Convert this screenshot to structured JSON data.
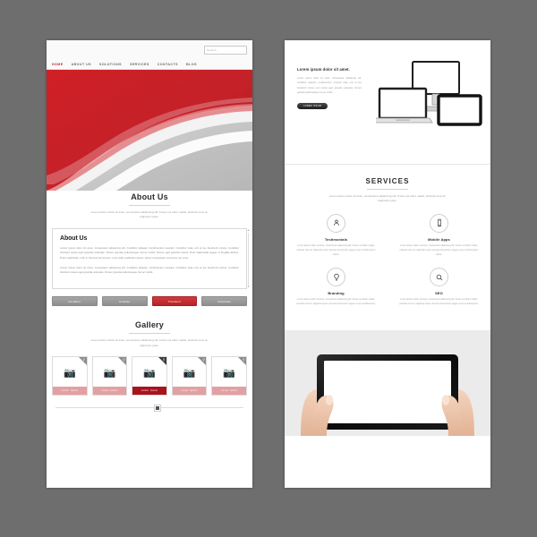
{
  "meta": {
    "background_color": "#6e6e6e",
    "accent_red": "#b5222a",
    "accent_dark": "#1d1d1d"
  },
  "left_page": {
    "header": {
      "search": {
        "placeholder": "Search",
        "value": ""
      },
      "nav_items": [
        {
          "label": "HOME",
          "active": true
        },
        {
          "label": "ABOUT US",
          "active": false
        },
        {
          "label": "SOLUTIONS",
          "active": false
        },
        {
          "label": "SERVICES",
          "active": false
        },
        {
          "label": "CONTACTS",
          "active": false
        },
        {
          "label": "BLOG",
          "active": false
        }
      ]
    },
    "hero": {
      "icon": "red-wave-banner"
    },
    "about": {
      "title": "About Us",
      "subtitle": "Lorem ipsum dolor sit amet, consectetur adipiscing elit. Fusce vel dolor mattis, pulvinar risus id, dignissim justo.",
      "box_title": "About Us",
      "paragraph_1": "Lorem ipsum dolor sit amet, consectetur adipiscing elit. Curabitur aliquam condimentum suscipit. Curabitur vitae orci et leo hendrerit cursus. Curabitur tincidunt metus eget gravida vulputate. Donec gravida pellentesque nisi ac mollis. Donec eget gravida mauris. Duis malesuada augue ut fringilla ultrices. Proin sollicitudin, nibh in rhoncus fermentum, eros nulla vestibulum lacus, varius consectetur est lectus nec eros.",
      "paragraph_2": "Lorem ipsum dolor sit amet, consectetur adipiscing elit. Curabitur aliquam condimentum suscipit. Curabitur vitae orci et leo hendrerit cursus. Curabitur tincidunt metus eget gravida vulputate. Donec gravida pellentesque nisi ac mollis.",
      "scroll_up_icon": "chevron-up-icon",
      "scroll_down_icon": "chevron-down-icon",
      "buttons": [
        {
          "label": "Curabitur",
          "style": "gray"
        },
        {
          "label": "Gravida",
          "style": "gray"
        },
        {
          "label": "Tincidunt",
          "style": "red"
        },
        {
          "label": "Vulputate",
          "style": "gray"
        }
      ]
    },
    "gallery": {
      "title": "Gallery",
      "subtitle": "Lorem ipsum dolor sit amet, consectetur adipiscing elit. Fusce vel dolor mattis, pulvinar risus id, dignissim justo.",
      "items": [
        {
          "icon": "image-placeholder-icon",
          "corner_icon": "zoom-icon",
          "tag_left": "Lorem",
          "tag_right": "Ipsum",
          "active": false
        },
        {
          "icon": "image-placeholder-icon",
          "corner_icon": "zoom-icon",
          "tag_left": "Lorem",
          "tag_right": "Ipsum",
          "active": false
        },
        {
          "icon": "image-placeholder-icon",
          "corner_icon": "zoom-icon",
          "tag_left": "Lorem",
          "tag_right": "Ipsum",
          "active": true
        },
        {
          "icon": "image-placeholder-icon",
          "corner_icon": "zoom-icon",
          "tag_left": "Lorem",
          "tag_right": "Ipsum",
          "active": false
        },
        {
          "icon": "image-placeholder-icon",
          "corner_icon": "zoom-icon",
          "tag_left": "Lorem",
          "tag_right": "Ipsum",
          "active": false
        }
      ],
      "slider_position_percent": 53
    }
  },
  "right_page": {
    "intro": {
      "heading": "Lorem ipsum dolor sit amet.",
      "body": "Lorem ipsum dolor sit amet, consectetur adipiscing elit. Curabitur aliquam condimentum suscipit vitae orci et leo hendrerit cursus nec metus eget gravida vulputate. Donec gravida pellentesque nisi ac mollis.",
      "button_label": "LOREM IPSUM",
      "illustration_icon": "devices-monitor-laptop-tablet-icon"
    },
    "services": {
      "title": "SERVICES",
      "subtitle": "Lorem ipsum dolor sit amet, consectetur adipiscing elit. Fusce vel dolor mattis, pulvinar risus id, dignissim justo.",
      "items": [
        {
          "icon": "user-testimonial-icon",
          "name": "Testimonials",
          "text": "Lorem ipsum dolor sit amet, consectetur adipiscing elit. Fusce vel dolor mattis, pulvinar risus id, dignissim justo. Aenean fermentum augue et leo condimentum varius."
        },
        {
          "icon": "mobile-phone-icon",
          "name": "Mobile Apps",
          "text": "Lorem ipsum dolor sit amet, consectetur adipiscing elit. Fusce vel dolor mattis, pulvinar risus id, dignissim justo. Aenean fermentum augue et leo condimentum varius."
        },
        {
          "icon": "lightbulb-icon",
          "name": "Branding",
          "text": "Lorem ipsum dolor sit amet, consectetur adipiscing elit. Fusce vel dolor mattis, pulvinar risus id, dignissim justo. Aenean fermentum augue et leo condimentum."
        },
        {
          "icon": "magnifier-search-icon",
          "name": "SEO",
          "text": "Lorem ipsum dolor sit amet, consectetur adipiscing elit. Fusce vel dolor mattis, pulvinar risus id, dignissim justo. Aenean fermentum augue et leo condimentum."
        }
      ]
    },
    "showcase": {
      "icon": "hands-holding-tablet-icon"
    }
  }
}
